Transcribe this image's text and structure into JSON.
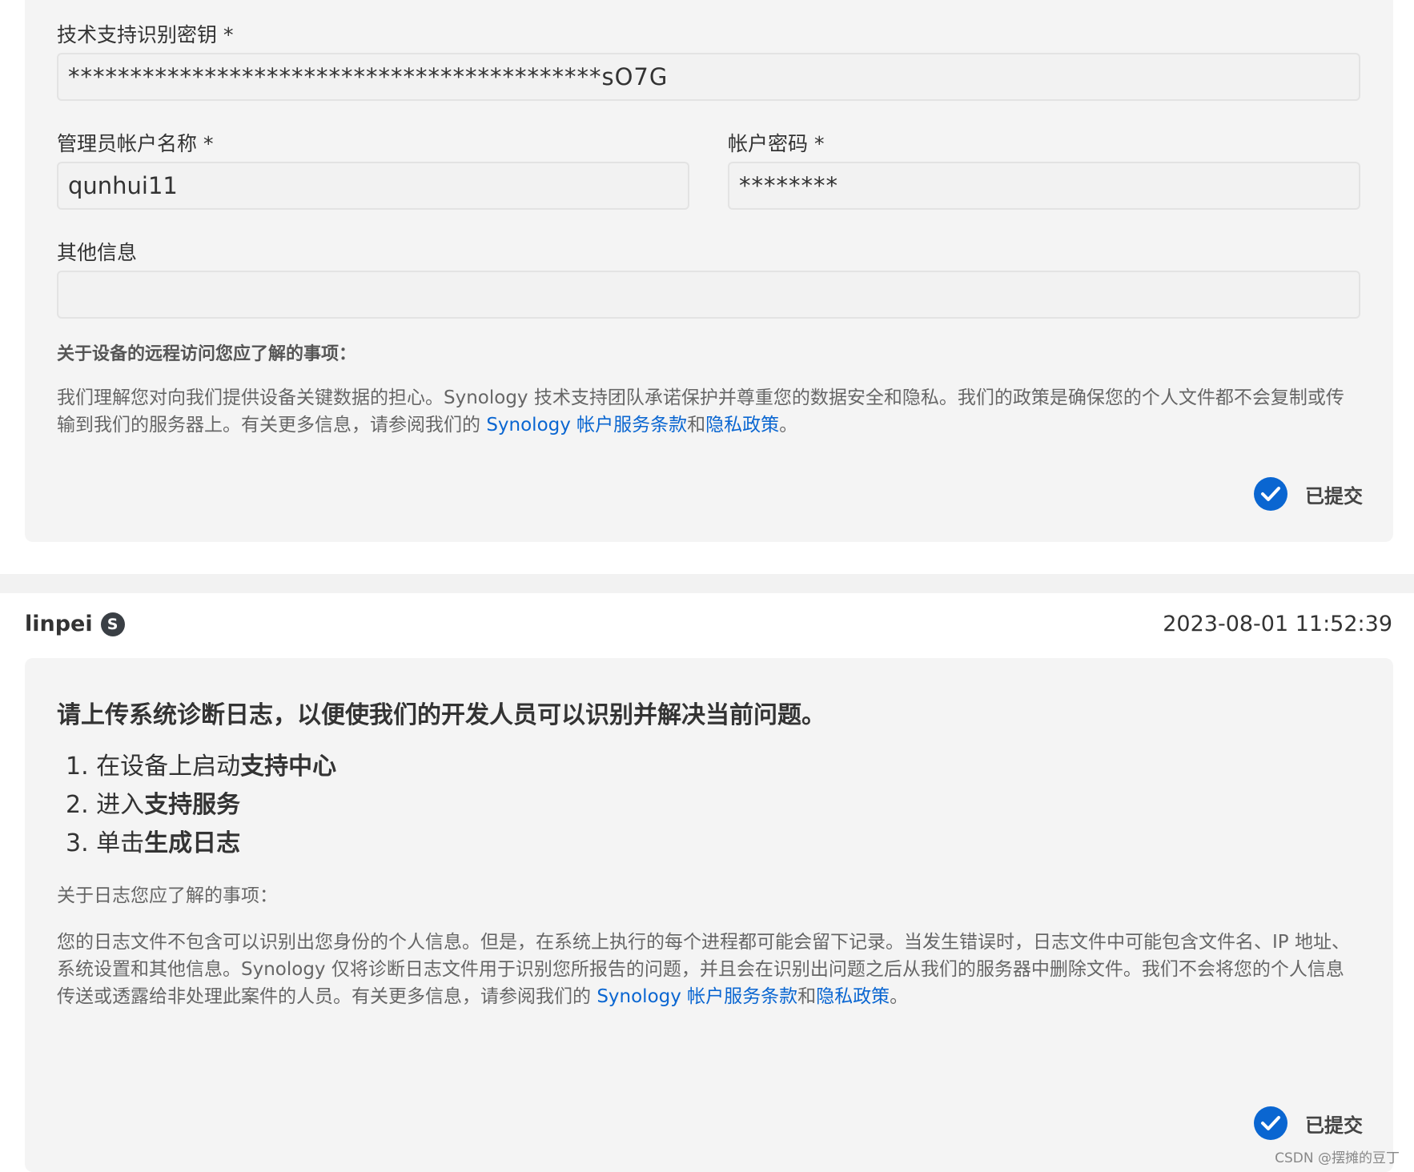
{
  "form": {
    "key_label": "技术支持识别密钥 *",
    "key_value": "*******************************************sO7G",
    "admin_label": "管理员帐户名称 *",
    "admin_value": "qunhui11",
    "password_label": "帐户密码 *",
    "password_value": "********",
    "other_label": "其他信息",
    "other_value": ""
  },
  "remote_notice": {
    "heading": "关于设备的远程访问您应了解的事项：",
    "text": "我们理解您对向我们提供设备关键数据的担心。Synology 技术支持团队承诺保护并尊重您的数据安全和隐私。我们的政策是确保您的个人文件都不会复制或传输到我们的服务器上。有关更多信息，请参阅我们的 ",
    "terms_link": "Synology 帐户服务条款",
    "and": "和",
    "privacy_link": "隐私政策",
    "end": "。"
  },
  "submitted_label": "已提交",
  "message": {
    "username": "linpei",
    "badge": "S",
    "timestamp": "2023-08-01 11:52:39",
    "title": "请上传系统诊断日志，以便使我们的开发人员可以识别并解决当前问题。",
    "steps": [
      {
        "num": "1.",
        "prefix": "在设备上启动",
        "bold": "支持中心"
      },
      {
        "num": "2.",
        "prefix": "进入",
        "bold": "支持服务"
      },
      {
        "num": "3.",
        "prefix": "单击",
        "bold": "生成日志"
      }
    ],
    "log_heading": "关于日志您应了解的事项：",
    "log_text": "您的日志文件不包含可以识别出您身份的个人信息。但是，在系统上执行的每个进程都可能会留下记录。当发生错误时，日志文件中可能包含文件名、IP 地址、系统设置和其他信息。Synology 仅将诊断日志文件用于识别您所报告的问题，并且会在识别出问题之后从我们的服务器中删除文件。我们不会将您的个人信息传送或透露给非处理此案件的人员。有关更多信息，请参阅我们的 ",
    "terms_link": "Synology 帐户服务条款",
    "and": "和",
    "privacy_link": "隐私政策",
    "end": "。"
  },
  "watermark": "CSDN @摆摊的豆丁",
  "colors": {
    "accent": "#0a66d1",
    "card_bg": "#f4f4f4",
    "badge_bg": "#3a3f45"
  }
}
